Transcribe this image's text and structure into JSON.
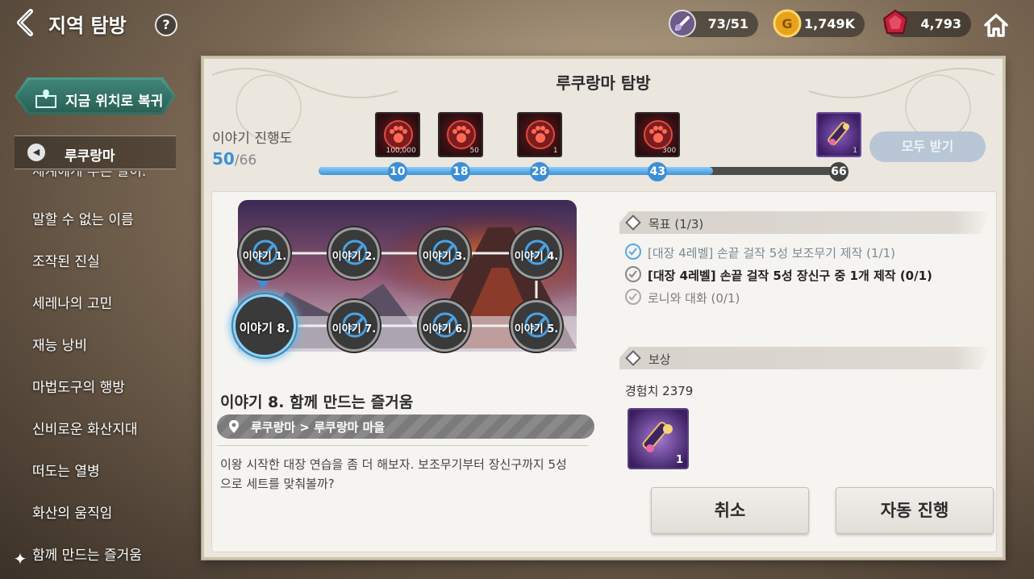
{
  "header": {
    "title": "지역 탐방",
    "help_icon": "question-badge-icon",
    "currencies": [
      {
        "name": "stamina",
        "icon": "potion-icon",
        "value": "73/51"
      },
      {
        "name": "gold",
        "icon": "gold-coin-icon",
        "value": "1,749K"
      },
      {
        "name": "gem",
        "icon": "red-gem-icon",
        "value": "4,793"
      }
    ],
    "home_icon": "home-icon"
  },
  "sidebar": {
    "return_button": "지금 위치로 복귀",
    "region": "루쿠랑마",
    "chapters": [
      "세계에게 부른 말이.",
      "말할 수 없는 이름",
      "조작된 진실",
      "세레나의 고민",
      "재능 낭비",
      "마법도구의 행방",
      "신비로운 화산지대",
      "떠도는 열병",
      "화산의 움직임",
      "함께 만드는 즐거움"
    ]
  },
  "panel": {
    "title": "루쿠랑마 탐방",
    "progress_label": "이야기 진행도",
    "progress_current": "50",
    "progress_total": "/66",
    "progress_fraction": 0.7576,
    "milestones": [
      {
        "value": "10",
        "frac": 0.1515,
        "reached": true,
        "reward_qty": "100,000",
        "reward_icon": "paw-emblem-icon"
      },
      {
        "value": "18",
        "frac": 0.2727,
        "reached": true,
        "reward_qty": "50",
        "reward_icon": "paw-emblem-icon"
      },
      {
        "value": "28",
        "frac": 0.4242,
        "reached": true,
        "reward_qty": "1",
        "reward_icon": "paw-emblem-icon"
      },
      {
        "value": "43",
        "frac": 0.6515,
        "reached": true,
        "reward_qty": "300",
        "reward_icon": "paw-emblem-icon"
      },
      {
        "value": "66",
        "frac": 1.0,
        "reached": false,
        "reward_qty": "1",
        "reward_icon": "scroll-icon"
      }
    ],
    "claim_all": "모두 받기",
    "map_nodes": [
      {
        "label": "이야기 1.",
        "state": "cleared"
      },
      {
        "label": "이야기 2.",
        "state": "cleared"
      },
      {
        "label": "이야기 3.",
        "state": "cleared"
      },
      {
        "label": "이야기 4.",
        "state": "cleared"
      },
      {
        "label": "이야기 5.",
        "state": "cleared"
      },
      {
        "label": "이야기 6.",
        "state": "cleared"
      },
      {
        "label": "이야기 7.",
        "state": "cleared"
      },
      {
        "label": "이야기 8.",
        "state": "current"
      }
    ],
    "story_title": "이야기 8. 함께 만드는 즐거움",
    "location": "루쿠랑마 > 루쿠랑마 마을",
    "story_desc": "이왕 시작한 대장 연습을 좀 더 해보자. 보조무기부터 장신구까지 5성으로 세트를 맞춰볼까?",
    "objectives_header": "목표 (1/3)",
    "objectives": [
      {
        "text": "[대장 4레벨] 손끝 걸작 5성 보조무기 제작 (1/1)",
        "state": "done"
      },
      {
        "text": "[대장 4레벨] 손끝 걸작 5성 장신구 중 1개 제작 (0/1)",
        "state": "active"
      },
      {
        "text": "로니와 대화 (0/1)",
        "state": "todo"
      }
    ],
    "rewards_header": "보상",
    "exp": "경험치 2379",
    "reward_item": {
      "icon": "scroll-icon",
      "qty": "1"
    },
    "cancel_button": "취소",
    "auto_button": "자동 진행"
  },
  "colors": {
    "accent_blue": "#3c8fd6",
    "panel_bg": "#ebe7df",
    "locked_gray": "#444444"
  }
}
